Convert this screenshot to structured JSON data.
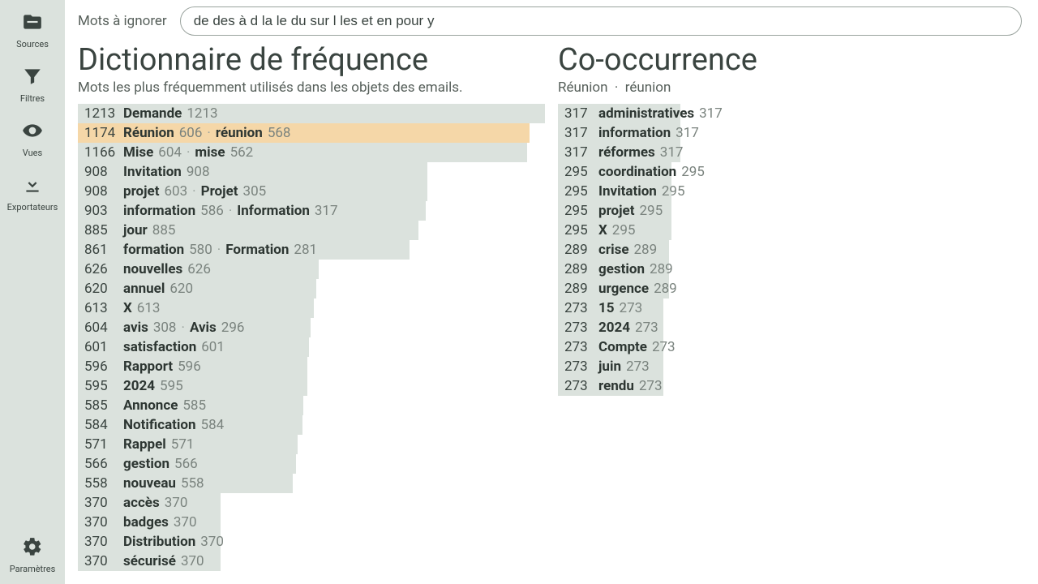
{
  "sidebar": {
    "items": [
      {
        "name": "sources",
        "label": "Sources",
        "icon": "folder"
      },
      {
        "name": "filtres",
        "label": "Filtres",
        "icon": "filter"
      },
      {
        "name": "vues",
        "label": "Vues",
        "icon": "eye"
      },
      {
        "name": "exportateurs",
        "label": "Exportateurs",
        "icon": "download"
      }
    ],
    "settings_label": "Paramètres"
  },
  "ignore": {
    "label": "Mots à ignorer",
    "value": "de des à d la le du sur l les et en pour y"
  },
  "freq": {
    "title": "Dictionnaire de fréquence",
    "subtitle": "Mots les plus fréquemment utilisés dans les objets des emails.",
    "max": 1213,
    "selected_index": 1,
    "rows": [
      {
        "total": 1213,
        "parts": [
          {
            "w": "Demande",
            "n": 1213
          }
        ]
      },
      {
        "total": 1174,
        "parts": [
          {
            "w": "Réunion",
            "n": 606
          },
          {
            "w": "réunion",
            "n": 568
          }
        ]
      },
      {
        "total": 1166,
        "parts": [
          {
            "w": "Mise",
            "n": 604
          },
          {
            "w": "mise",
            "n": 562
          }
        ]
      },
      {
        "total": 908,
        "parts": [
          {
            "w": "Invitation",
            "n": 908
          }
        ]
      },
      {
        "total": 908,
        "parts": [
          {
            "w": "projet",
            "n": 603
          },
          {
            "w": "Projet",
            "n": 305
          }
        ]
      },
      {
        "total": 903,
        "parts": [
          {
            "w": "information",
            "n": 586
          },
          {
            "w": "Information",
            "n": 317
          }
        ]
      },
      {
        "total": 885,
        "parts": [
          {
            "w": "jour",
            "n": 885
          }
        ]
      },
      {
        "total": 861,
        "parts": [
          {
            "w": "formation",
            "n": 580
          },
          {
            "w": "Formation",
            "n": 281
          }
        ]
      },
      {
        "total": 626,
        "parts": [
          {
            "w": "nouvelles",
            "n": 626
          }
        ]
      },
      {
        "total": 620,
        "parts": [
          {
            "w": "annuel",
            "n": 620
          }
        ]
      },
      {
        "total": 613,
        "parts": [
          {
            "w": "X",
            "n": 613
          }
        ]
      },
      {
        "total": 604,
        "parts": [
          {
            "w": "avis",
            "n": 308
          },
          {
            "w": "Avis",
            "n": 296
          }
        ]
      },
      {
        "total": 601,
        "parts": [
          {
            "w": "satisfaction",
            "n": 601
          }
        ]
      },
      {
        "total": 596,
        "parts": [
          {
            "w": "Rapport",
            "n": 596
          }
        ]
      },
      {
        "total": 595,
        "parts": [
          {
            "w": "2024",
            "n": 595
          }
        ]
      },
      {
        "total": 585,
        "parts": [
          {
            "w": "Annonce",
            "n": 585
          }
        ]
      },
      {
        "total": 584,
        "parts": [
          {
            "w": "Notification",
            "n": 584
          }
        ]
      },
      {
        "total": 571,
        "parts": [
          {
            "w": "Rappel",
            "n": 571
          }
        ]
      },
      {
        "total": 566,
        "parts": [
          {
            "w": "gestion",
            "n": 566
          }
        ]
      },
      {
        "total": 558,
        "parts": [
          {
            "w": "nouveau",
            "n": 558
          }
        ]
      },
      {
        "total": 370,
        "parts": [
          {
            "w": "accès",
            "n": 370
          }
        ]
      },
      {
        "total": 370,
        "parts": [
          {
            "w": "badges",
            "n": 370
          }
        ]
      },
      {
        "total": 370,
        "parts": [
          {
            "w": "Distribution",
            "n": 370
          }
        ]
      },
      {
        "total": 370,
        "parts": [
          {
            "w": "sécurisé",
            "n": 370
          }
        ]
      }
    ]
  },
  "cooc": {
    "title": "Co-occurrence",
    "subtitle_parts": [
      "Réunion",
      "réunion"
    ],
    "max": 317,
    "rows": [
      {
        "total": 317,
        "w": "administratives",
        "n": 317
      },
      {
        "total": 317,
        "w": "information",
        "n": 317
      },
      {
        "total": 317,
        "w": "réformes",
        "n": 317
      },
      {
        "total": 295,
        "w": "coordination",
        "n": 295
      },
      {
        "total": 295,
        "w": "Invitation",
        "n": 295
      },
      {
        "total": 295,
        "w": "projet",
        "n": 295
      },
      {
        "total": 295,
        "w": "X",
        "n": 295
      },
      {
        "total": 289,
        "w": "crise",
        "n": 289
      },
      {
        "total": 289,
        "w": "gestion",
        "n": 289
      },
      {
        "total": 289,
        "w": "urgence",
        "n": 289
      },
      {
        "total": 273,
        "w": "15",
        "n": 273
      },
      {
        "total": 273,
        "w": "2024",
        "n": 273
      },
      {
        "total": 273,
        "w": "Compte",
        "n": 273
      },
      {
        "total": 273,
        "w": "juin",
        "n": 273
      },
      {
        "total": 273,
        "w": "rendu",
        "n": 273
      }
    ]
  }
}
